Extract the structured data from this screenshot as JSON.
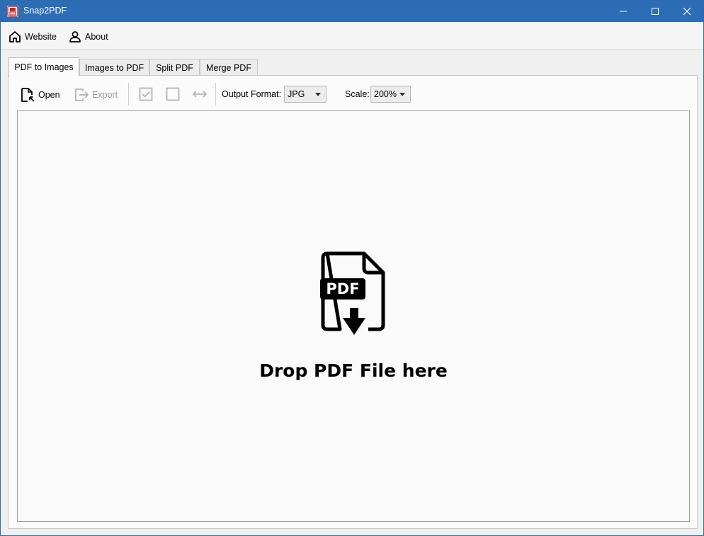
{
  "window": {
    "title": "Snap2PDF",
    "title_bar_color": "#2d6db5"
  },
  "menu": {
    "website_label": "Website",
    "website_icon": "home-icon",
    "about_label": "About",
    "about_icon": "user-icon"
  },
  "tabs": [
    {
      "label": "PDF to Images",
      "active": true
    },
    {
      "label": "Images to PDF",
      "active": false
    },
    {
      "label": "Split PDF",
      "active": false
    },
    {
      "label": "Merge PDF",
      "active": false
    }
  ],
  "toolbar": {
    "open_label": "Open",
    "export_label": "Export",
    "export_enabled": false,
    "output_format_label": "Output Format:",
    "output_format_value": "JPG",
    "scale_label": "Scale:",
    "scale_value": "200%"
  },
  "dropzone": {
    "icon": "pdf-download-icon",
    "icon_text": "PDF",
    "message": "Drop PDF File here"
  }
}
